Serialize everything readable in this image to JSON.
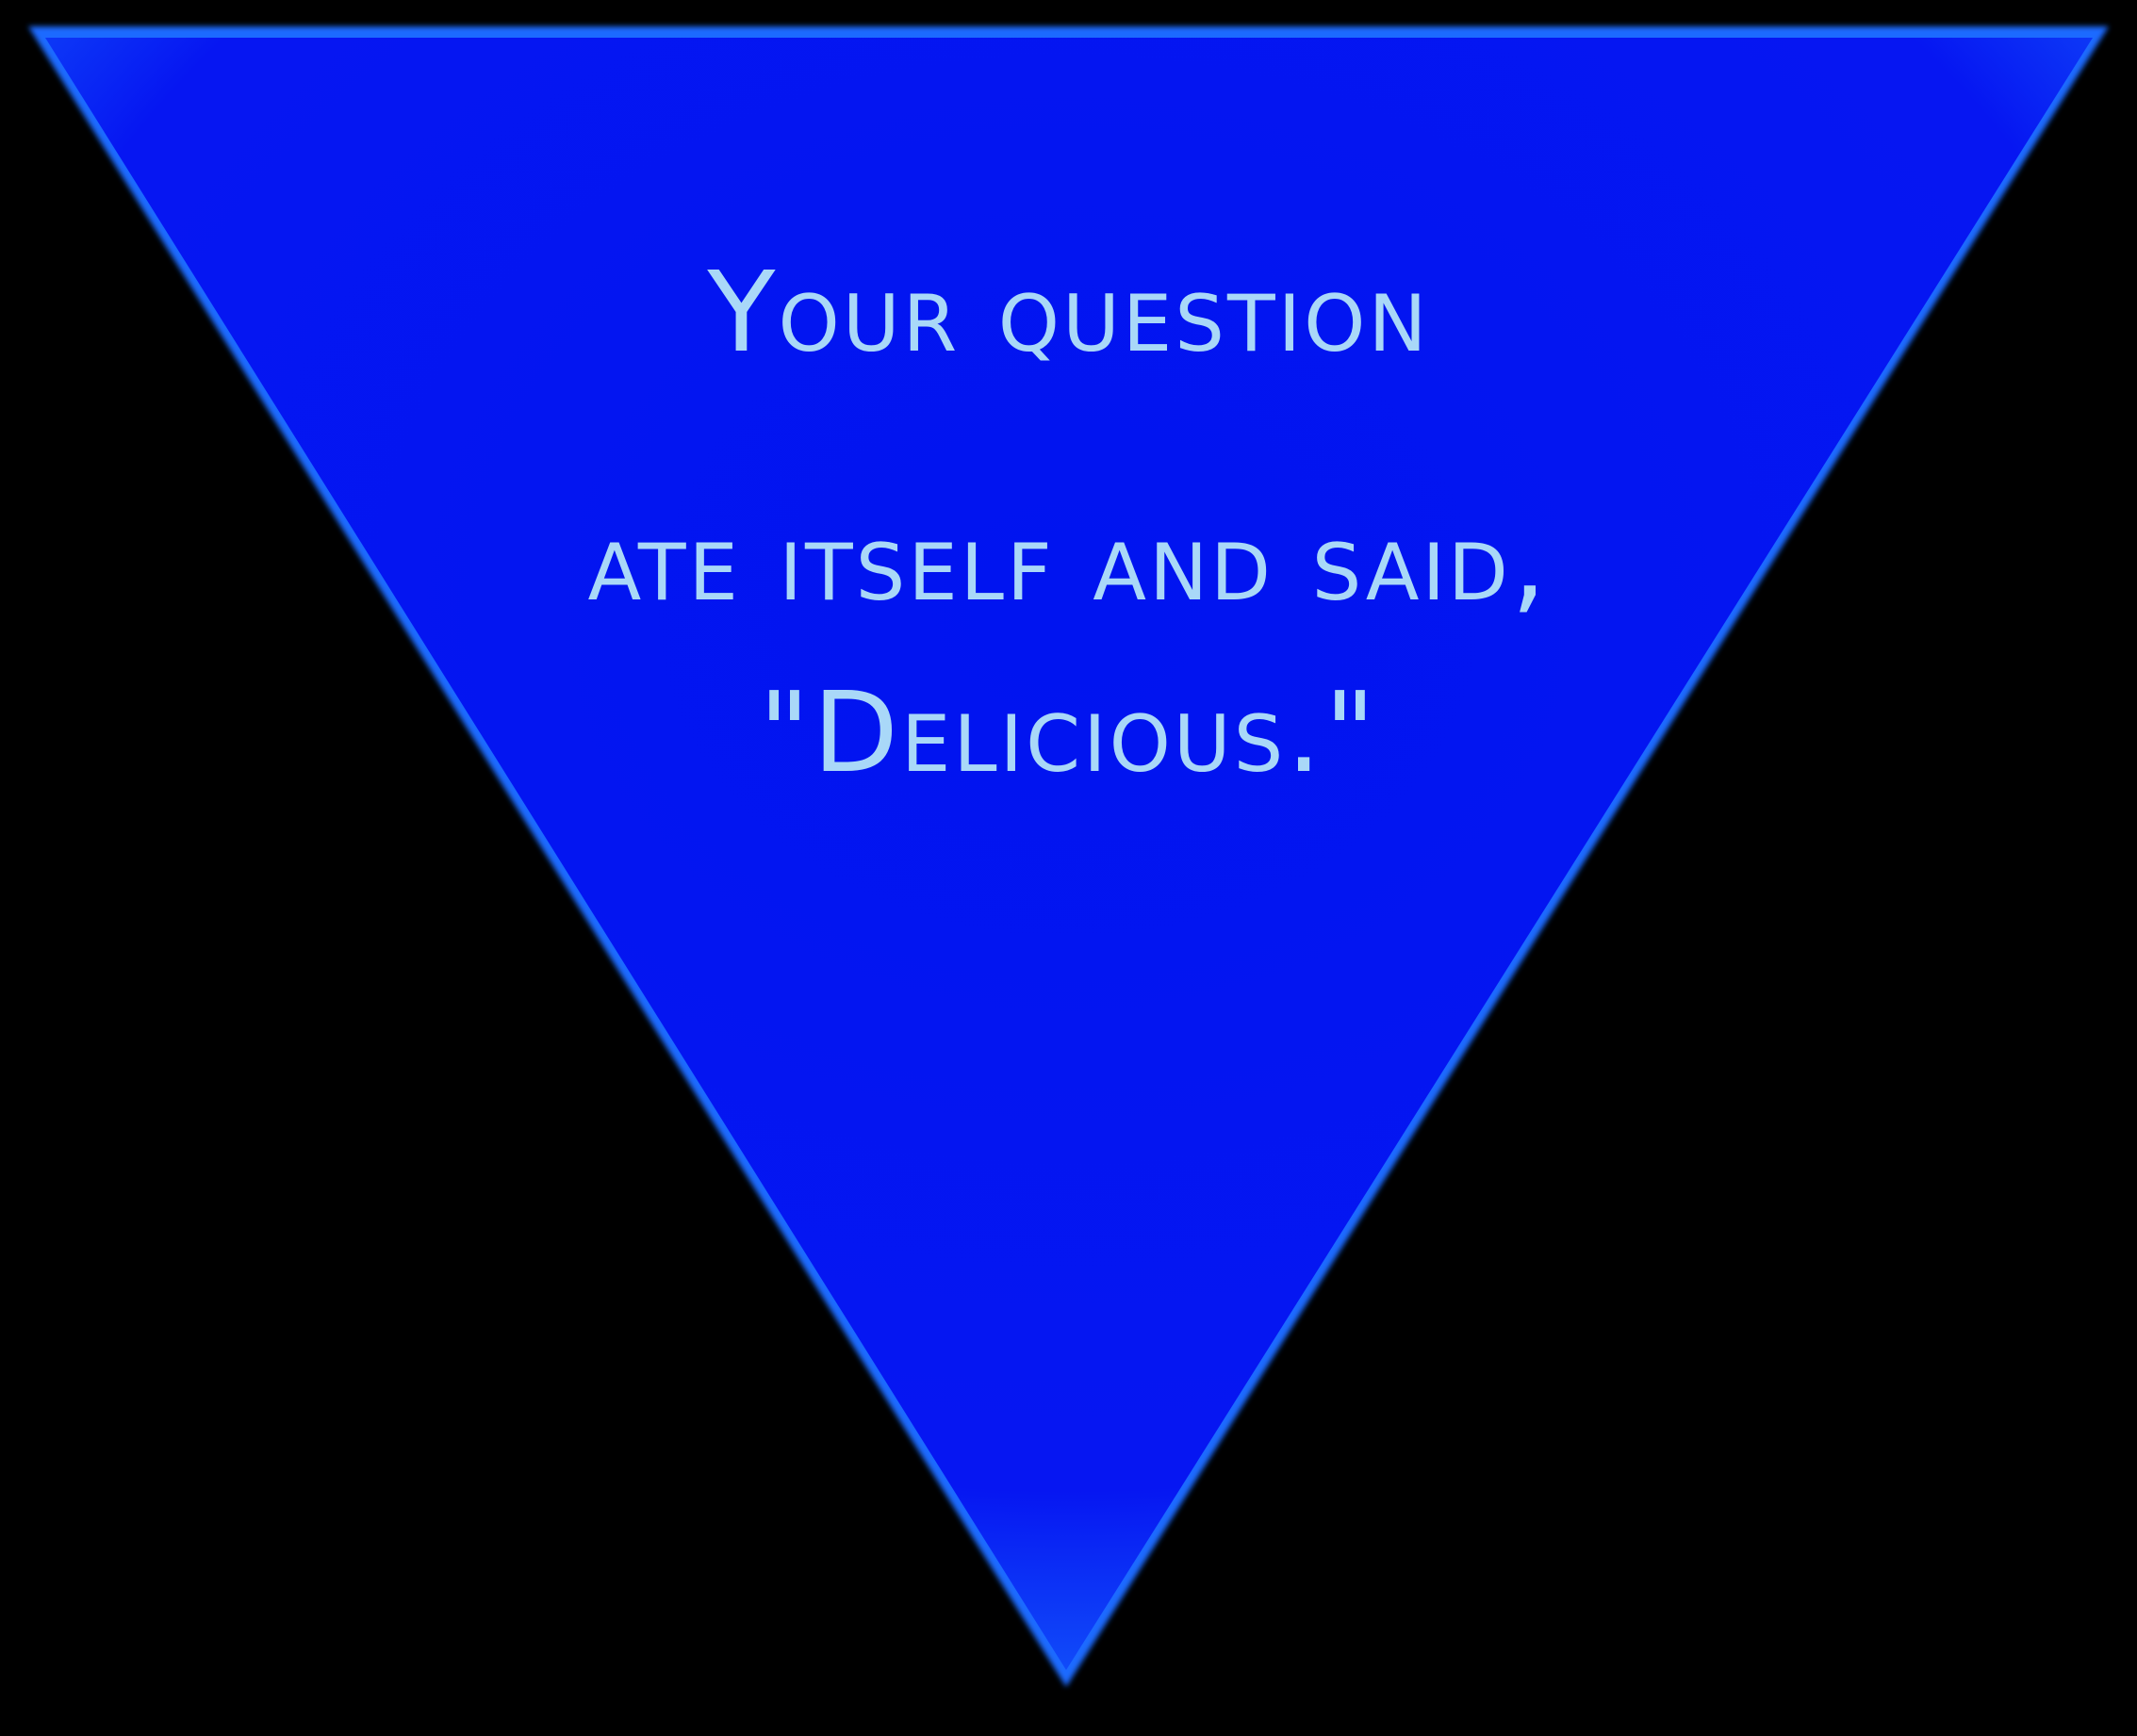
{
  "answer": {
    "lines": [
      "Your question",
      "ate itself and said,",
      "\"Delicious.\""
    ]
  },
  "colors": {
    "background": "#000000",
    "triangle_center": "#0014F0",
    "triangle_edge": "#1A7BFF",
    "text": "#A9D8F8"
  }
}
